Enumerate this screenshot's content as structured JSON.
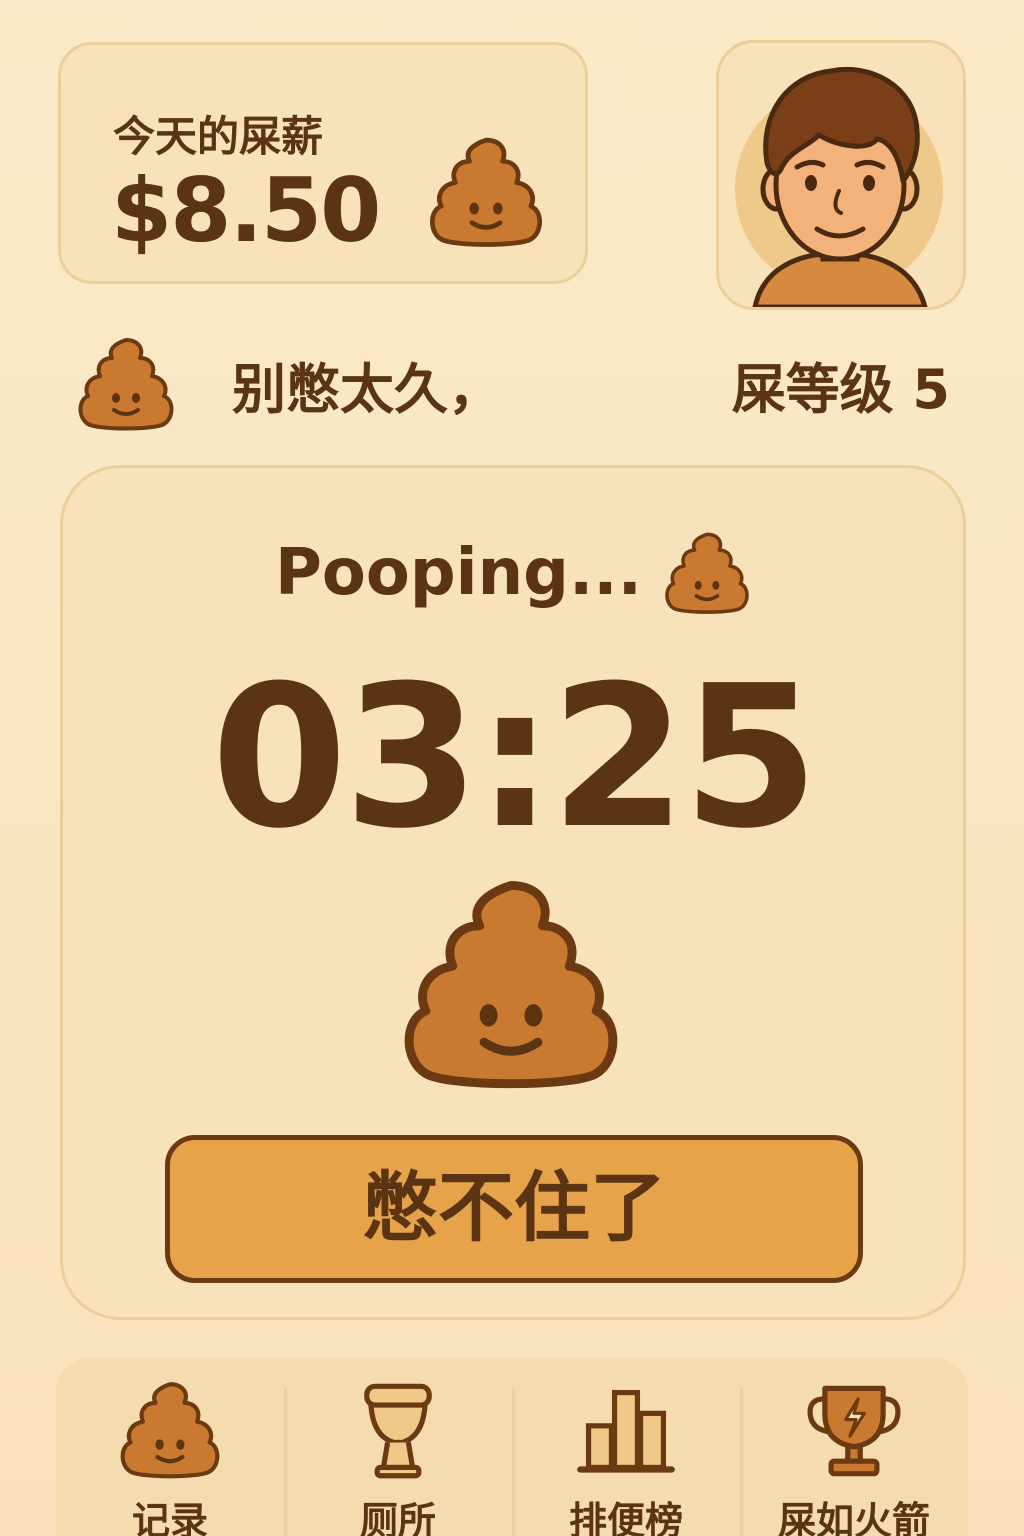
{
  "salary": {
    "label": "今天的屎薪",
    "amount": "$8.50"
  },
  "status": {
    "message": "别憋太久，",
    "level": "屎等级 5"
  },
  "timer": {
    "status_text": "Pooping...",
    "elapsed": "03:25",
    "hold_button_label": "憋不住了"
  },
  "nav": {
    "items": [
      {
        "label": "记录",
        "icon": "poop-icon"
      },
      {
        "label": "厕所",
        "icon": "toilet-icon"
      },
      {
        "label": "排便榜",
        "icon": "leaderboard-icon"
      },
      {
        "label": "屎如火箭",
        "icon": "trophy-icon"
      }
    ]
  },
  "colors": {
    "background": "#fbe7c4",
    "card": "#f8e2ba",
    "accent": "#e6a34a",
    "text": "#5a3413",
    "poop": "#c9782e"
  }
}
